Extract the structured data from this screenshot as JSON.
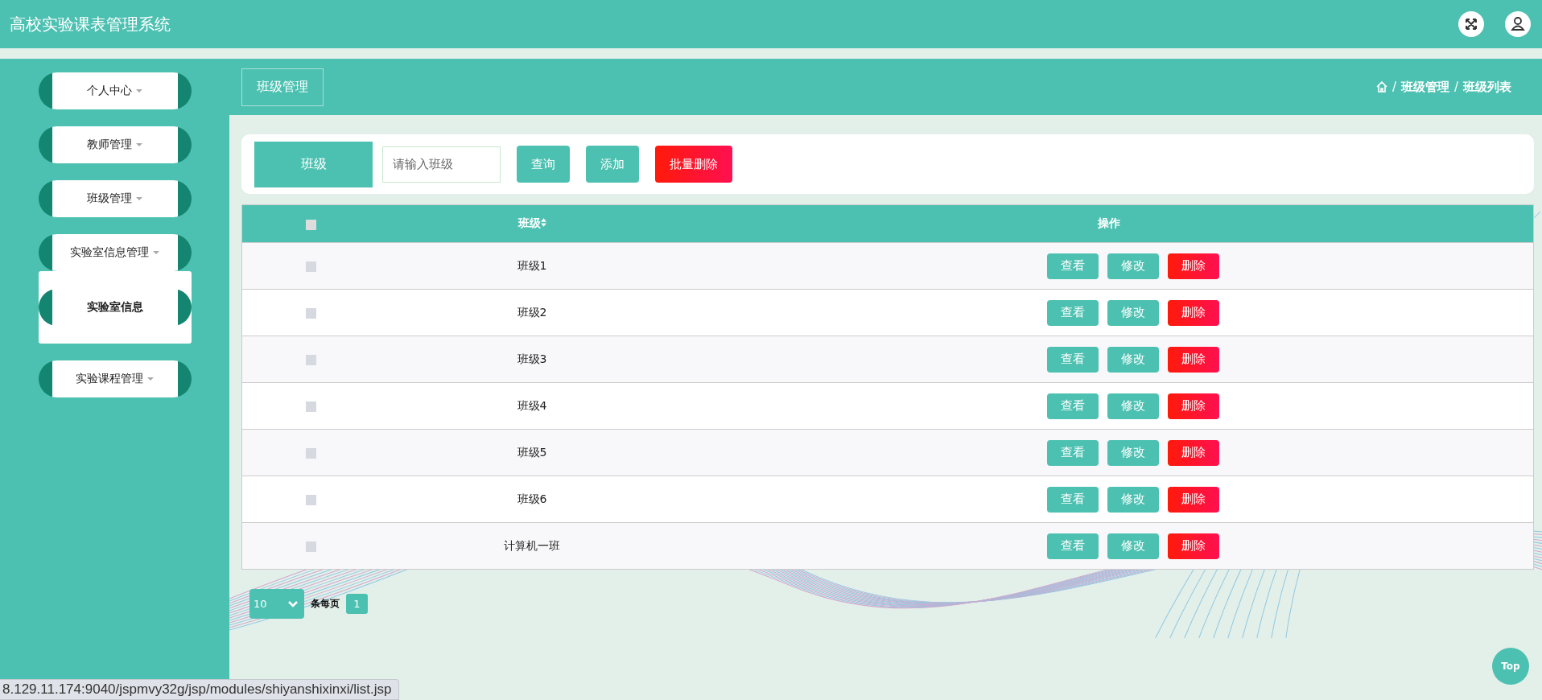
{
  "header": {
    "title": "高校实验课表管理系统"
  },
  "sidebar": {
    "items": [
      {
        "label": "个人中心",
        "expanded": false
      },
      {
        "label": "教师管理",
        "expanded": false
      },
      {
        "label": "班级管理",
        "expanded": false
      },
      {
        "label": "实验室信息管理",
        "expanded": true,
        "children": [
          {
            "label": "实验室信息"
          }
        ]
      },
      {
        "label": "实验课程管理",
        "expanded": false
      }
    ]
  },
  "page_header": {
    "title": "班级管理",
    "breadcrumb": [
      {
        "kind": "separator",
        "text": "/"
      },
      {
        "kind": "link",
        "text": "班级管理"
      },
      {
        "kind": "separator",
        "text": "/"
      },
      {
        "kind": "link",
        "text": "班级列表"
      }
    ]
  },
  "search": {
    "label": "班级",
    "placeholder": "请输入班级",
    "buttons": [
      {
        "label": "查询",
        "kind": "normal"
      },
      {
        "label": "添加",
        "kind": "normal"
      },
      {
        "label": "批量删除",
        "kind": "danger"
      }
    ]
  },
  "table": {
    "select_all": false,
    "columns": [
      "班级",
      "操作"
    ],
    "rows": [
      {
        "checked": false,
        "class": "班级1",
        "actions": [
          "查看",
          "修改",
          "删除"
        ]
      },
      {
        "checked": false,
        "class": "班级2",
        "actions": [
          "查看",
          "修改",
          "删除"
        ]
      },
      {
        "checked": false,
        "class": "班级3",
        "actions": [
          "查看",
          "修改",
          "删除"
        ]
      },
      {
        "checked": false,
        "class": "班级4",
        "actions": [
          "查看",
          "修改",
          "删除"
        ]
      },
      {
        "checked": false,
        "class": "班级5",
        "actions": [
          "查看",
          "修改",
          "删除"
        ]
      },
      {
        "checked": false,
        "class": "班级6",
        "actions": [
          "查看",
          "修改",
          "删除"
        ]
      },
      {
        "checked": false,
        "class": "计算机一班",
        "actions": [
          "查看",
          "修改",
          "删除"
        ]
      }
    ]
  },
  "pagination": {
    "page_size": "10",
    "label": "条每页",
    "pages": [
      {
        "label": "1",
        "selected": true
      }
    ]
  },
  "top_button": "Top",
  "status_bar": {
    "url": "8.129.11.174:9040/jspmvy32g/jsp/modules/shiyanshixinxi/list.jsp"
  }
}
